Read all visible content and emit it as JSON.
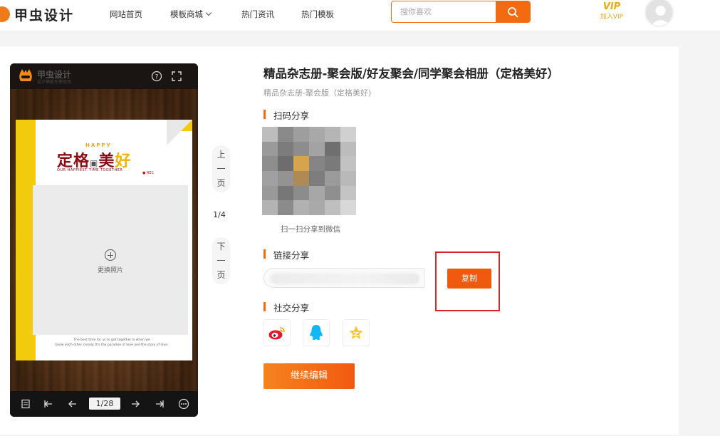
{
  "header": {
    "logo_text": "甲虫设计",
    "nav": [
      {
        "label": "网站首页"
      },
      {
        "label": "模板商城",
        "has_dropdown": true
      },
      {
        "label": "热门资讯"
      },
      {
        "label": "热门模板"
      }
    ],
    "search_placeholder": "搜你喜欢",
    "vip_badge": "VIP",
    "vip_label": "加入VIP"
  },
  "preview": {
    "logo_text": "甲虫设计",
    "logo_sub": "设计模板免费使用",
    "page_happy": "HAPPY",
    "page_title_a": "定格",
    "page_title_b": "美",
    "page_title_c": "好",
    "page_subtitle": "OUR HAPPIEST TIME TOGETHER",
    "rec": "● REC",
    "photo_label": "更换照片",
    "footer_line1": "The best time for us to get together is when we",
    "footer_line2": "know each other clearly. It's the paradise of love and the story of love.",
    "page_counter": "1/28"
  },
  "pager": {
    "prev": [
      "上",
      "一",
      "页"
    ],
    "next": [
      "下",
      "一",
      "页"
    ],
    "count": "1/4"
  },
  "info": {
    "title": "精品杂志册-聚会版/好友聚会/同学聚会相册（定格美好）",
    "subtitle": "精品杂志册-聚会版（定格美好)",
    "qr_section": "扫码分享",
    "qr_caption": "扫一扫分享到微信",
    "link_section": "链接分享",
    "copy_label": "复制",
    "social_section": "社交分享",
    "social": [
      "weibo-icon",
      "qq-icon",
      "qzone-icon"
    ],
    "edit_label": "继续编辑"
  },
  "colors": {
    "accent": "#f26b11",
    "highlight": "#d8282b"
  }
}
